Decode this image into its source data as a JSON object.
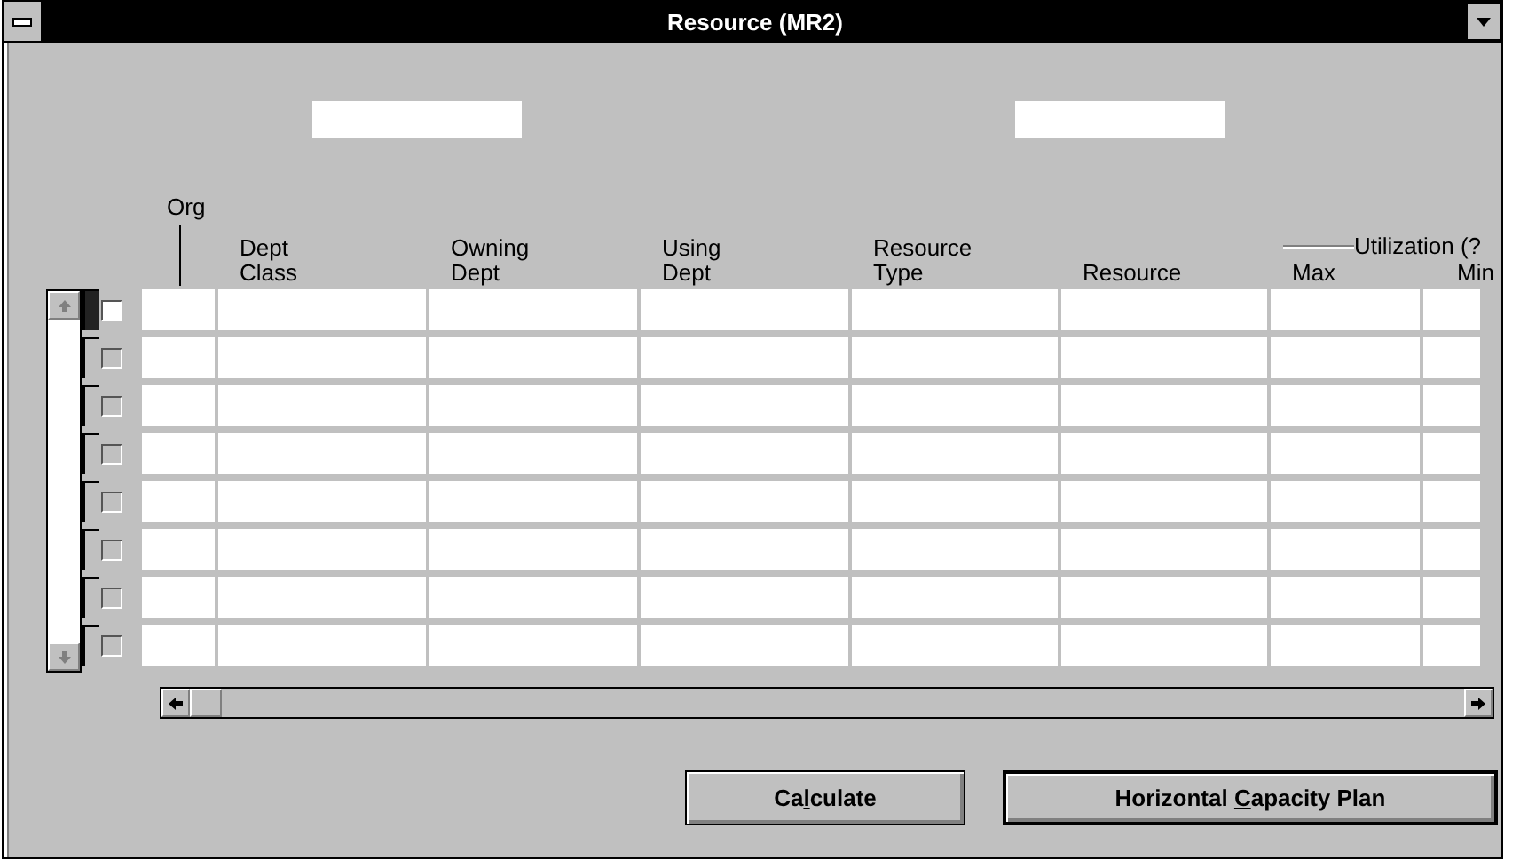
{
  "window": {
    "title": "Resource (MR2)"
  },
  "table": {
    "org_heading": "Org",
    "group_heading": "Utilization (?",
    "columns": [
      {},
      {
        "line1": "Dept",
        "line2": "Class"
      },
      {
        "line1": "Owning",
        "line2": "Dept"
      },
      {
        "line1": "Using",
        "line2": "Dept"
      },
      {
        "line1": "Resource",
        "line2": "Type"
      },
      {
        "line2": "Resource"
      },
      {
        "line2": "Max"
      },
      {
        "line2": "Min"
      }
    ],
    "rows": [
      {
        "current": true,
        "checked": false
      },
      {
        "current": false,
        "checked": false
      },
      {
        "current": false,
        "checked": false
      },
      {
        "current": false,
        "checked": false
      },
      {
        "current": false,
        "checked": false
      },
      {
        "current": false,
        "checked": false
      },
      {
        "current": false,
        "checked": false
      },
      {
        "current": false,
        "checked": false
      }
    ]
  },
  "buttons": [
    {
      "label_start": "Ca",
      "mnemonic": "l",
      "label_end": "culate",
      "default": false
    },
    {
      "label_start": "Horizontal ",
      "mnemonic": "C",
      "label_end": "apacity Plan",
      "default": true
    }
  ]
}
